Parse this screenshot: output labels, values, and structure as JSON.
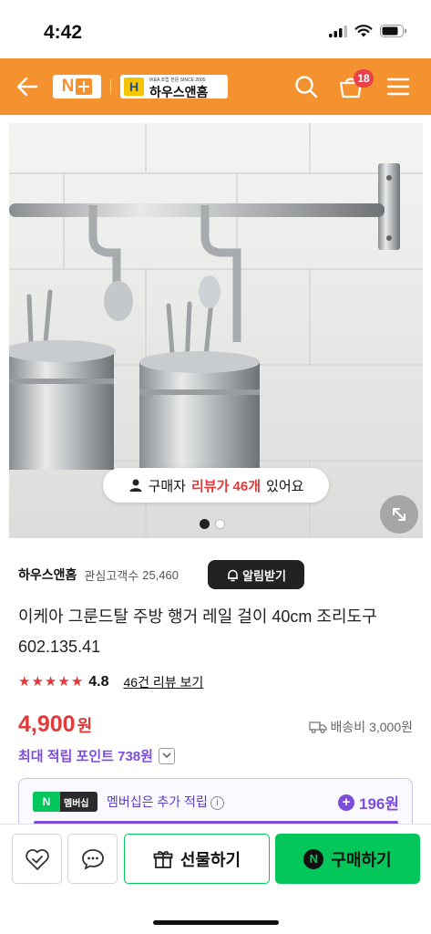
{
  "status_bar": {
    "time": "4:42"
  },
  "header": {
    "nplus_logo": "N",
    "store_logo_sub": "IKEA 조립 전문 SINCE 2005",
    "store_logo_name": "하우스앤홈",
    "cart_count": "18",
    "accent_color": "#f4922f"
  },
  "product_image": {
    "review_pill": {
      "prefix": "구매자",
      "highlight": "리뷰가 46개",
      "suffix": "있어요"
    },
    "pager": {
      "current": 1,
      "total": 2
    }
  },
  "store": {
    "name": "하우스앤홈",
    "interest_label": "관심고객수",
    "interest_count": "25,460",
    "notify_label": "알림받기"
  },
  "product": {
    "title": "이케아 그룬드탈 주방 행거 레일 걸이 40cm 조리도구 602.135.41",
    "rating": "4.8",
    "stars": 5,
    "review_link": "46건 리뷰 보기",
    "price": "4,900",
    "price_unit": "원",
    "shipping": "배송비 3,000원",
    "points_label": "최대 적립 포인트 738원",
    "price_color": "#e23a3a",
    "points_color": "#7c4ddb"
  },
  "membership": {
    "badge_n": "N",
    "badge_label": "멤버십",
    "text": "멤버십은 추가 적립",
    "info": "i",
    "points": "196원"
  },
  "bottom_bar": {
    "gift_label": "선물하기",
    "buy_label": "구매하기",
    "npay_mark": "N",
    "buy_color": "#03c75a"
  }
}
